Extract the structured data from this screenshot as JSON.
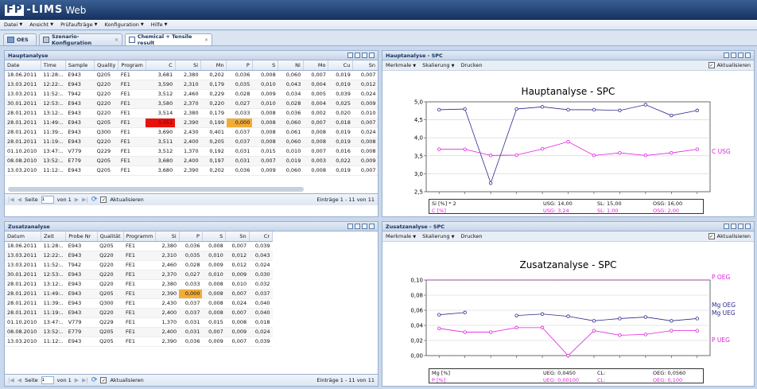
{
  "app": {
    "logo_fp": "FP",
    "logo_lims": "-LIMS",
    "logo_web": "Web"
  },
  "menu": [
    {
      "label": "Datei"
    },
    {
      "label": "Ansicht"
    },
    {
      "label": "Prüfaufträge"
    },
    {
      "label": "Konfiguration"
    },
    {
      "label": "Hilfe"
    }
  ],
  "tabs": [
    {
      "label": "OES"
    },
    {
      "label": "Szenario-Konfiguration"
    },
    {
      "label": "Chemical + Tensile result"
    }
  ],
  "haupt": {
    "title": "Hauptanalyse",
    "columns": [
      "Date",
      "Time",
      "Sample",
      "Quality",
      "Program",
      "C",
      "Si",
      "Mn",
      "P",
      "S",
      "Ni",
      "Mo",
      "Cu",
      "Sn"
    ],
    "rows": [
      [
        "18.06.2011",
        "11:28:..",
        "E943",
        "Q205",
        "FE1",
        "3,681",
        "2,380",
        "0,202",
        "0,036",
        "0,008",
        "0,060",
        "0,007",
        "0,019",
        "0,007"
      ],
      [
        "13.03.2011",
        "12:22:..",
        "E943",
        "Q220",
        "FE1",
        "3,590",
        "2,310",
        "0,179",
        "0,035",
        "0,010",
        "0,043",
        "0,004",
        "0,019",
        "0,012"
      ],
      [
        "13.03.2011",
        "11:52:..",
        "T942",
        "Q220",
        "FE1",
        "3,512",
        "2,460",
        "0,229",
        "0,028",
        "0,009",
        "0,034",
        "0,005",
        "0,039",
        "0,024"
      ],
      [
        "30.01.2011",
        "12:53:..",
        "E943",
        "Q220",
        "FE1",
        "3,580",
        "2,370",
        "0,220",
        "0,027",
        "0,010",
        "0,028",
        "0,004",
        "0,025",
        "0,009"
      ],
      [
        "28.01.2011",
        "13:12:..",
        "E943",
        "Q220",
        "FE1",
        "3,514",
        "2,380",
        "0,179",
        "0,033",
        "0,008",
        "0,036",
        "0,002",
        "0,020",
        "0,010"
      ],
      [
        "28.01.2011",
        "11:49:..",
        "E943",
        "Q205",
        "FE1",
        "3,051",
        "2,390",
        "0,199",
        "0,000",
        "0,008",
        "0,060",
        "0,007",
        "0,018",
        "0,007"
      ],
      [
        "28.01.2011",
        "11:39:..",
        "E943",
        "Q300",
        "FE1",
        "3,690",
        "2,430",
        "0,401",
        "0,037",
        "0,008",
        "0,061",
        "0,008",
        "0,019",
        "0,024"
      ],
      [
        "28.01.2011",
        "11:19:..",
        "E943",
        "Q220",
        "FE1",
        "3,511",
        "2,400",
        "0,205",
        "0,037",
        "0,008",
        "0,060",
        "0,008",
        "0,019",
        "0,008"
      ],
      [
        "01.10.2010",
        "13:47:..",
        "V779",
        "Q229",
        "FE1",
        "3,512",
        "1,370",
        "0,192",
        "0,031",
        "0,015",
        "0,010",
        "0,007",
        "0,016",
        "0,008"
      ],
      [
        "08.08.2010",
        "13:52:..",
        "E779",
        "Q205",
        "FE1",
        "3,680",
        "2,400",
        "0,197",
        "0,031",
        "0,007",
        "0,019",
        "0,003",
        "0,022",
        "0,009"
      ],
      [
        "13.03.2010",
        "11:12:..",
        "E943",
        "Q205",
        "FE1",
        "3,680",
        "2,390",
        "0,202",
        "0,036",
        "0,009",
        "0,060",
        "0,008",
        "0,019",
        "0,007"
      ]
    ],
    "highlight": {
      "red": [
        5,
        5
      ],
      "orange": [
        5,
        8
      ]
    },
    "pager": {
      "page_label": "Seite",
      "page": "1",
      "of": "von 1",
      "refresh": "Aktualisieren",
      "entries": "Einträge 1 - 11 von 11"
    }
  },
  "zusatz": {
    "title": "Zusatzanalyse",
    "columns": [
      "Datum",
      "Zeit",
      "Probe Nr",
      "Qualität",
      "Programm",
      "Si",
      "P",
      "S",
      "Sn",
      "Cr"
    ],
    "rows": [
      [
        "18.06.2011",
        "11:28:..",
        "E943",
        "Q205",
        "FE1",
        "2,380",
        "0,036",
        "0,008",
        "0,007",
        "0,039"
      ],
      [
        "13.03.2011",
        "12:22:..",
        "E943",
        "Q220",
        "FE1",
        "2,310",
        "0,035",
        "0,010",
        "0,012",
        "0,043"
      ],
      [
        "13.03.2011",
        "11:52:..",
        "T942",
        "Q220",
        "FE1",
        "2,460",
        "0,028",
        "0,009",
        "0,012",
        "0,024"
      ],
      [
        "30.01.2011",
        "12:53:..",
        "E943",
        "Q220",
        "FE1",
        "2,370",
        "0,027",
        "0,010",
        "0,009",
        "0,030"
      ],
      [
        "28.01.2011",
        "13:12:..",
        "E943",
        "Q220",
        "FE1",
        "2,380",
        "0,033",
        "0,008",
        "0,010",
        "0,032"
      ],
      [
        "28.01.2011",
        "11:49:..",
        "E943",
        "Q205",
        "FE1",
        "2,390",
        "0,000",
        "0,008",
        "0,007",
        "0,037"
      ],
      [
        "28.01.2011",
        "11:39:..",
        "E943",
        "Q300",
        "FE1",
        "2,430",
        "0,037",
        "0,008",
        "0,024",
        "0,040"
      ],
      [
        "28.01.2011",
        "11:19:..",
        "E943",
        "Q220",
        "FE1",
        "2,400",
        "0,037",
        "0,008",
        "0,007",
        "0,040"
      ],
      [
        "01.10.2010",
        "13:47:..",
        "V779",
        "Q229",
        "FE1",
        "1,370",
        "0,031",
        "0,015",
        "0,008",
        "0,018"
      ],
      [
        "08.08.2010",
        "13:52:..",
        "E779",
        "Q205",
        "FE1",
        "2,400",
        "0,031",
        "0,007",
        "0,009",
        "0,024"
      ],
      [
        "13.03.2010",
        "11:12:..",
        "E943",
        "Q205",
        "FE1",
        "2,390",
        "0,036",
        "0,009",
        "0,007",
        "0,039"
      ]
    ],
    "highlight": {
      "orange": [
        5,
        6
      ]
    },
    "pager": {
      "page_label": "Seite",
      "page": "1",
      "of": "von 1",
      "refresh": "Aktualisieren",
      "entries": "Einträge 1 - 11 von 11"
    }
  },
  "spc1": {
    "panel_title": "Hauptanalyse - SPC",
    "toolbar": [
      "Merkmale",
      "Skalierung",
      "Drucken"
    ],
    "refresh": "Aktualisieren",
    "legend": [
      {
        "name": "Si [%] * 2",
        "usg": "USG: 14,00",
        "sl": "SL: 15,00",
        "osg": "OSG: 16,00",
        "color": "#000"
      },
      {
        "name": "C [%]",
        "usg": "USG: 3,24",
        "sl": "SL: 1,00",
        "osg": "OSG: 2,00",
        "color": "#e020e0"
      }
    ]
  },
  "spc2": {
    "panel_title": "Zusatzanalyse - SPC",
    "toolbar": [
      "Merkmale",
      "Skalierung",
      "Drucken"
    ],
    "refresh": "Aktualisieren",
    "legend": [
      {
        "name": "Mg [%]",
        "usg": "UEG: 0,0450",
        "sl": "CL:",
        "osg": "OEG: 0,0560",
        "color": "#000"
      },
      {
        "name": "P [%]",
        "usg": "UEG: 0,00100",
        "sl": "CL:",
        "osg": "OEG: 0,100",
        "color": "#e020e0"
      }
    ]
  },
  "chart_data": [
    {
      "type": "line",
      "title": "Hauptanalyse - SPC",
      "ylim": [
        2.5,
        5.0
      ],
      "yticks": [
        "5,0",
        "4,5",
        "4,0",
        "3,5",
        "3,0",
        "2,5"
      ],
      "series": [
        {
          "name": "Si [%] * 2",
          "color": "#2c2c8c",
          "values": [
            4.78,
            4.8,
            2.74,
            4.8,
            4.86,
            4.78,
            4.78,
            4.76,
            4.92,
            4.62,
            4.76
          ]
        },
        {
          "name": "C [%]",
          "color": "#e020e0",
          "values": [
            3.68,
            3.68,
            3.51,
            3.52,
            3.69,
            3.89,
            3.51,
            3.58,
            3.51,
            3.58,
            3.68
          ]
        }
      ],
      "annotations": [
        {
          "label": "C USG",
          "color": "#e020e0"
        }
      ]
    },
    {
      "type": "line",
      "title": "Zusatzanalyse - SPC",
      "ylim": [
        0,
        0.1
      ],
      "yticks": [
        "0,10",
        "0,08",
        "0,06",
        "0,04",
        "0,02",
        "0,00"
      ],
      "series": [
        {
          "name": "Mg [%]",
          "color": "#2c2c8c",
          "values": [
            0.054,
            0.057,
            null,
            0.053,
            0.055,
            0.052,
            0.046,
            0.049,
            0.051,
            0.046,
            0.049
          ]
        },
        {
          "name": "P [%]",
          "color": "#e020e0",
          "values": [
            0.036,
            0.031,
            0.031,
            0.037,
            0.037,
            0.0,
            0.033,
            0.027,
            0.028,
            0.033,
            0.033
          ]
        }
      ],
      "annotations": [
        {
          "label": "P OEG",
          "color": "#e020e0"
        },
        {
          "label": "Mg OEG",
          "color": "#2c2c8c"
        },
        {
          "label": "Mg UEG",
          "color": "#2c2c8c"
        },
        {
          "label": "P UEG",
          "color": "#e020e0"
        }
      ]
    }
  ]
}
